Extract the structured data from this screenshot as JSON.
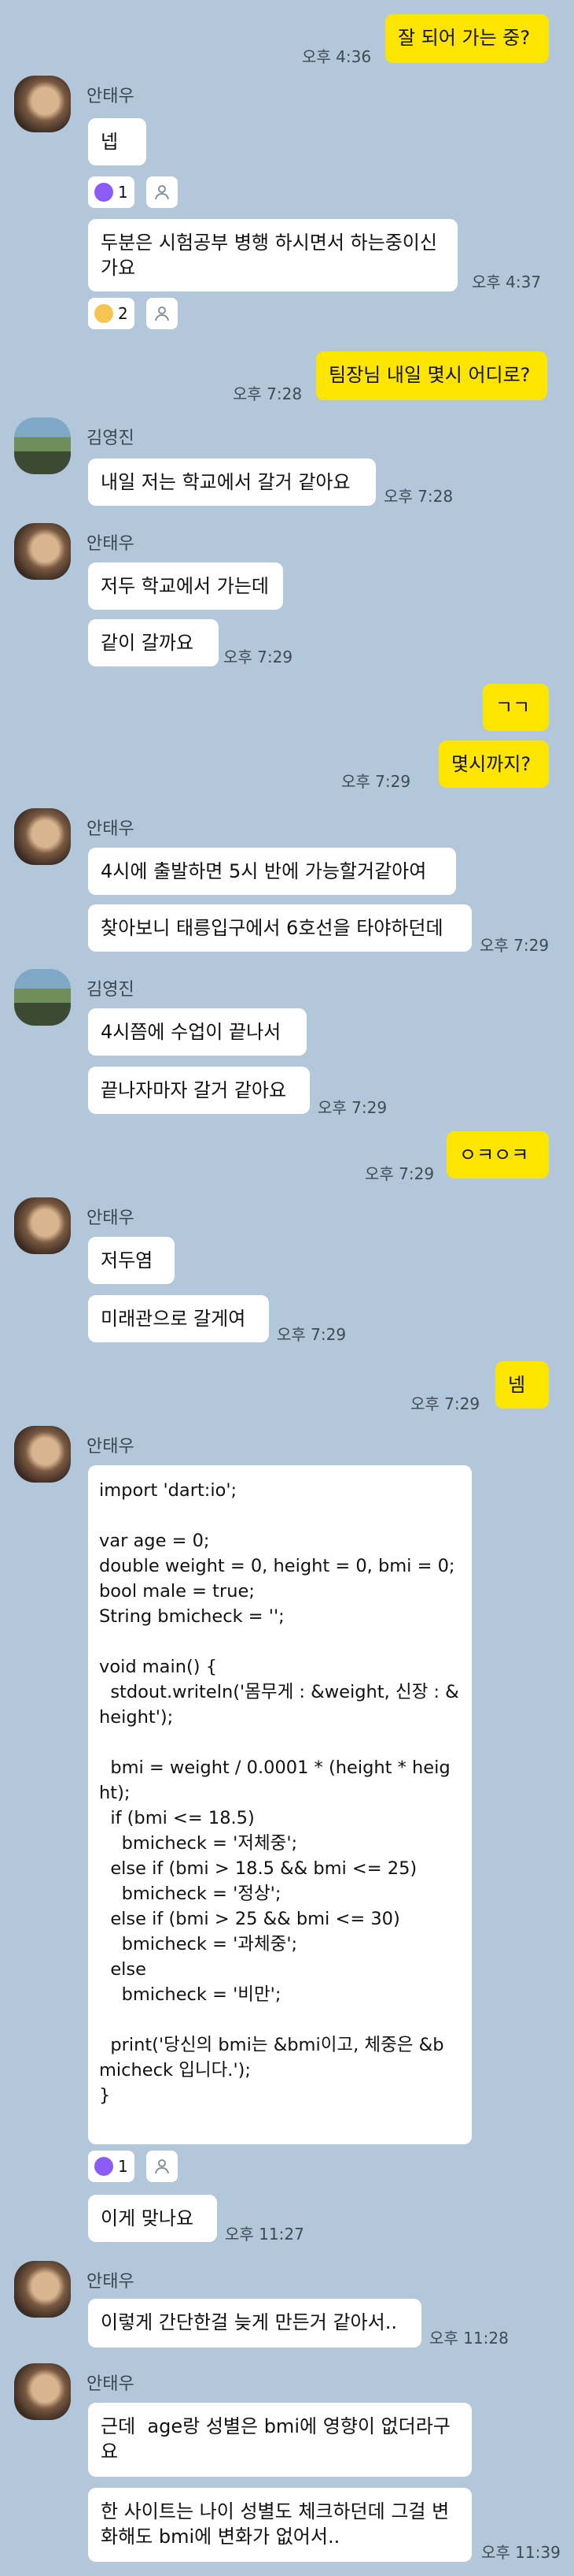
{
  "colors": {
    "background": "#b2c7da",
    "incoming_bubble": "#ffffff",
    "outgoing_bubble": "#fee500"
  },
  "icons": {
    "reaction_like": "purple-thumbs-up",
    "reaction_sad": "sad-face",
    "member": "person-outline"
  },
  "senders": {
    "teawoo": "안태우",
    "yeongjin": "김영진"
  },
  "messages": [
    {
      "text": "잘 되어 가는 중?",
      "time": "오후 4:36"
    },
    {
      "text": "넵"
    },
    {
      "text": "두분은 시험공부 병행 하시면서 하는중이신가요",
      "time": "오후 4:37"
    },
    {
      "text": "팀장님 내일 몇시 어디로?",
      "time": "오후 7:28"
    },
    {
      "text": "내일 저는 학교에서 갈거 같아요",
      "time": "오후 7:28"
    },
    {
      "text": "저두 학교에서 가는데"
    },
    {
      "text": "같이 갈까요",
      "time": "오후 7:29"
    },
    {
      "text": "ㄱㄱ"
    },
    {
      "text": "몇시까지?",
      "time": "오후 7:29"
    },
    {
      "text": "4시에 출발하면 5시 반에 가능할거같아여"
    },
    {
      "text": "찾아보니 태릉입구에서 6호선을 타야하던데",
      "time": "오후 7:29"
    },
    {
      "text": "4시쯤에 수업이 끝나서"
    },
    {
      "text": "끝나자마자 갈거 같아요",
      "time": "오후 7:29"
    },
    {
      "text": "ㅇㅋㅇㅋ",
      "time": "오후 7:29"
    },
    {
      "text": "저두염"
    },
    {
      "text": "미래관으로 갈게여",
      "time": "오후 7:29"
    },
    {
      "text": "넴",
      "time": "오후 7:29"
    },
    {
      "text": "import 'dart:io';\n\nvar age = 0;\ndouble weight = 0, height = 0, bmi = 0;\nbool male = true;\nString bmicheck = '';\n\nvoid main() {\n  stdout.writeln('몸무게 : &weight, 신장 : &height');\n\n  bmi = weight / 0.0001 * (height * height);\n  if (bmi <= 18.5)\n    bmicheck = '저체중';\n  else if (bmi > 18.5 && bmi <= 25)\n    bmicheck = '정상';\n  else if (bmi > 25 && bmi <= 30)\n    bmicheck = '과체중';\n  else\n    bmicheck = '비만';\n\n  print('당신의 bmi는 &bmi이고, 체중은 &bmicheck 입니다.');\n}"
    },
    {
      "text": "이게 맞나요",
      "time": "오후 11:27"
    },
    {
      "text": "이렇게 간단한걸 늦게 만든거 같아서..",
      "time": "오후 11:28"
    },
    {
      "text": "근데  age랑 성별은 bmi에 영향이 없더라구요"
    },
    {
      "text": "한 사이트는 나이 성별도 체크하던데 그걸 변화해도 bmi에 변화가 없어서..",
      "time": "오후 11:39"
    }
  ],
  "reactions": [
    {
      "count": "1"
    },
    {
      "count": "2"
    },
    {
      "count": "1"
    }
  ]
}
